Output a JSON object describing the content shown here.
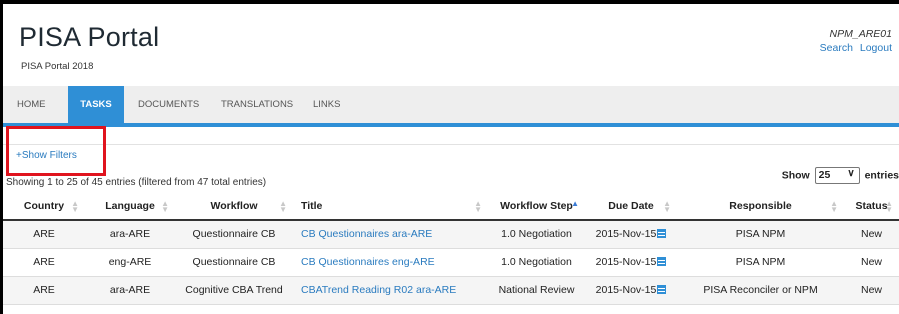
{
  "header": {
    "title": "PISA Portal",
    "subtitle": "PISA Portal 2018",
    "username": "NPM_ARE01",
    "links": [
      "Search",
      "Logout"
    ]
  },
  "nav": {
    "items": [
      "HOME",
      "TASKS",
      "DOCUMENTS",
      "TRANSLATIONS",
      "LINKS"
    ],
    "active": "TASKS"
  },
  "filters": {
    "label": "+Show Filters"
  },
  "info": {
    "text": "Showing 1 to 25 of 45 entries (filtered from 47 total entries)"
  },
  "length": {
    "prefix": "Show",
    "value": "25",
    "suffix": "entries"
  },
  "table": {
    "columns": [
      "Country",
      "Language",
      "Workflow",
      "Title",
      "Workflow Step",
      "Due Date",
      "Responsible",
      "Status"
    ],
    "sorted_column": "Workflow Step",
    "rows": [
      [
        "ARE",
        "ara-ARE",
        "Questionnaire CB",
        "CB Questionnaires ara-ARE",
        "1.0 Negotiation",
        "2015-Nov-15",
        "PISA NPM",
        "New"
      ],
      [
        "ARE",
        "eng-ARE",
        "Questionnaire CB",
        "CB Questionnaires eng-ARE",
        "1.0 Negotiation",
        "2015-Nov-15",
        "PISA NPM",
        "New"
      ],
      [
        "ARE",
        "ara-ARE",
        "Cognitive CBA Trend",
        "CBATrend Reading R02 ara-ARE",
        "National Review",
        "2015-Nov-15",
        "PISA Reconciler or NPM",
        "New"
      ]
    ]
  },
  "colors": {
    "accent": "#2f8fd6",
    "link": "#2a7bbf",
    "highlight_box": "#e0141e"
  },
  "icons": {
    "due_date": "calendar-icon",
    "sort": "sort-arrows-icon"
  }
}
